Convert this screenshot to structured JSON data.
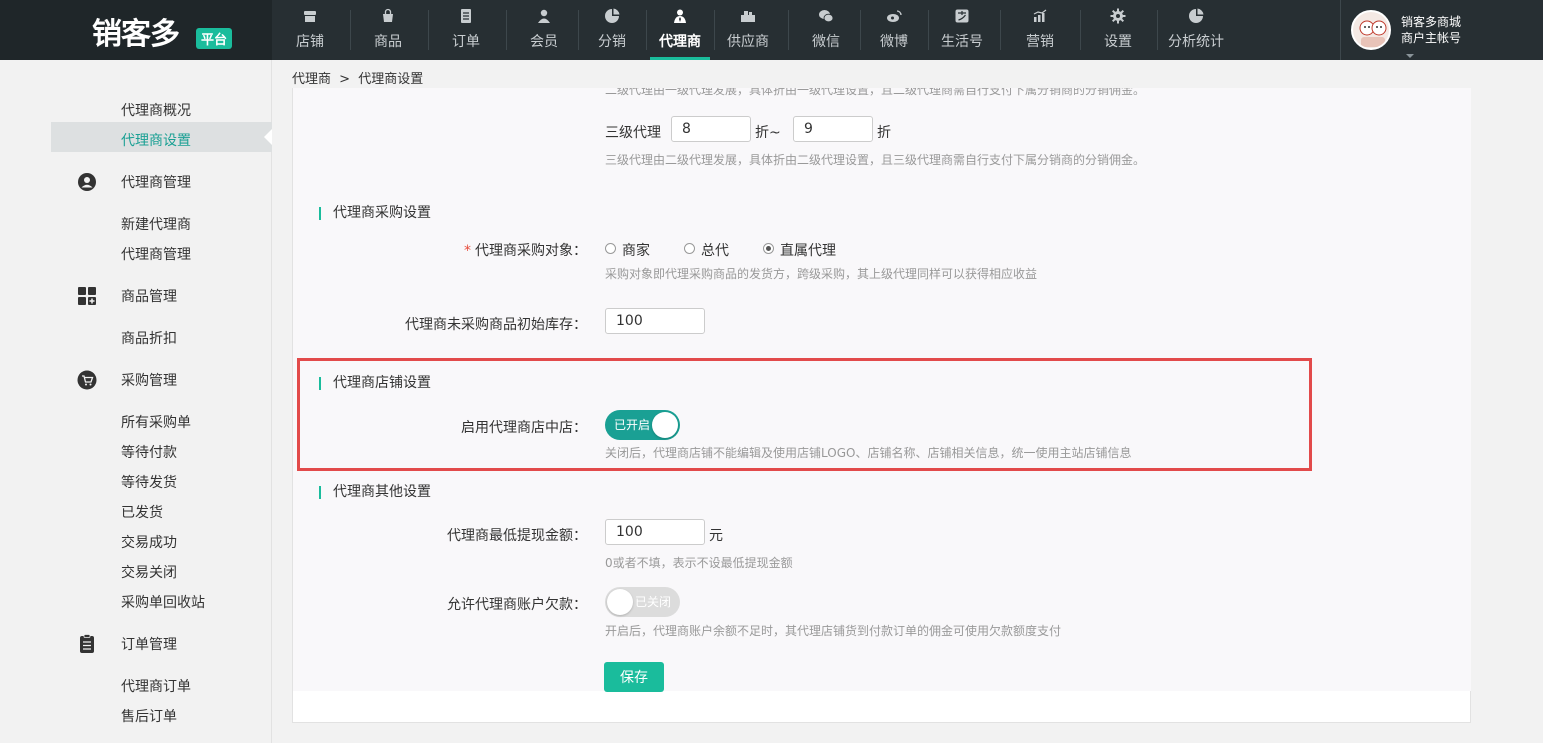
{
  "header": {
    "logo_text": "销客多",
    "logo_badge": "平台",
    "nav": [
      {
        "label": "店铺",
        "icon": "store-icon"
      },
      {
        "label": "商品",
        "icon": "bag-icon"
      },
      {
        "label": "订单",
        "icon": "order-icon"
      },
      {
        "label": "会员",
        "icon": "member-icon"
      },
      {
        "label": "分销",
        "icon": "pie-icon"
      },
      {
        "label": "代理商",
        "icon": "agent-icon",
        "active": true
      },
      {
        "label": "供应商",
        "icon": "supplier-icon"
      },
      {
        "label": "微信",
        "icon": "wechat-icon"
      },
      {
        "label": "微博",
        "icon": "weibo-icon"
      },
      {
        "label": "生活号",
        "icon": "alipay-icon"
      },
      {
        "label": "营销",
        "icon": "chart-icon"
      },
      {
        "label": "设置",
        "icon": "gear-icon"
      },
      {
        "label": "分析统计",
        "icon": "analytics-icon"
      }
    ],
    "user_name": "销客多商城",
    "user_role": "商户主帐号"
  },
  "sidebar": {
    "top_items": [
      {
        "label": "代理商概况"
      },
      {
        "label": "代理商设置",
        "active": true
      }
    ],
    "groups": [
      {
        "label": "代理商管理",
        "icon": "user-circle-icon",
        "items": [
          "新建代理商",
          "代理商管理"
        ]
      },
      {
        "label": "商品管理",
        "icon": "grid-icon",
        "items": [
          "商品折扣"
        ]
      },
      {
        "label": "采购管理",
        "icon": "cart-icon",
        "items": [
          "所有采购单",
          "等待付款",
          "等待发货",
          "已发货",
          "交易成功",
          "交易关闭",
          "采购单回收站"
        ]
      },
      {
        "label": "订单管理",
        "icon": "clipboard-icon",
        "items": [
          "代理商订单",
          "售后订单"
        ]
      }
    ]
  },
  "breadcrumb": {
    "root": "代理商",
    "sep": ">",
    "current": "代理商设置"
  },
  "content": {
    "cut_help": "二级代理由一级代理发展，具体折由一级代理设置，且二级代理商需自行支付下属分销商的分销佣金。",
    "level3": {
      "label": "三级代理",
      "from": "8",
      "mid_unit": "折~",
      "to": "9",
      "unit": "折",
      "help": "三级代理由二级代理发展，具体折由二级代理设置，且三级代理商需自行支付下属分销商的分销佣金。"
    },
    "purchase": {
      "title": "代理商采购设置",
      "target_label": "代理商采购对象：",
      "required_mark": "*",
      "options": [
        "商家",
        "总代",
        "直属代理"
      ],
      "selected": "直属代理",
      "target_help": "采购对象即代理采购商品的发货方，跨级采购，其上级代理同样可以获得相应收益",
      "stock_label": "代理商未采购商品初始库存：",
      "stock_value": "100"
    },
    "store": {
      "title": "代理商店铺设置",
      "enable_label": "启用代理商店中店：",
      "toggle_text": "已开启",
      "help": "关闭后，代理商店铺不能编辑及使用店铺LOGO、店铺名称、店铺相关信息，统一使用主站店铺信息"
    },
    "other": {
      "title": "代理商其他设置",
      "min_withdraw_label": "代理商最低提现金额：",
      "min_withdraw_value": "100",
      "min_withdraw_unit": "元",
      "min_withdraw_help": "0或者不填，表示不设最低提现金额",
      "debt_label": "允许代理商账户欠款：",
      "debt_toggle_text": "已关闭",
      "debt_help": "开启后，代理商账户余额不足时，其代理店铺货到付款订单的佣金可使用欠款额度支付"
    },
    "save_label": "保存"
  },
  "colors": {
    "accent": "#1abc9c",
    "topbar": "#272f33",
    "highlight": "#e24a4a"
  }
}
